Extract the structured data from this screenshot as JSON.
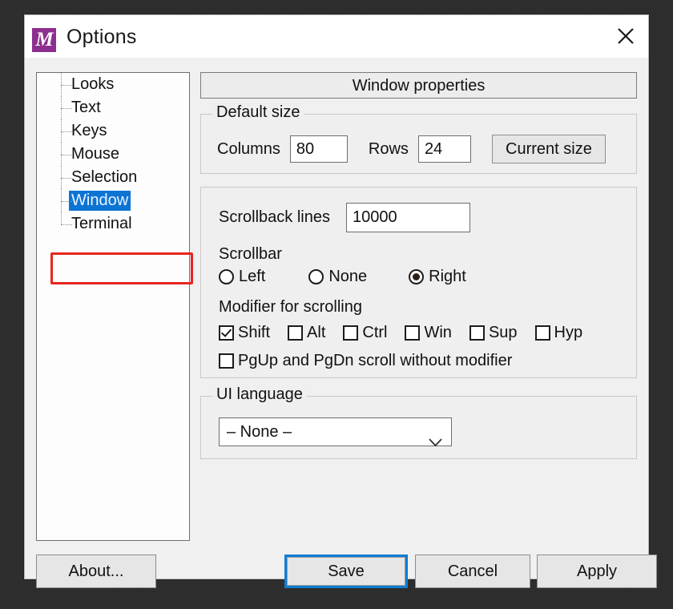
{
  "window": {
    "title": "Options",
    "app_icon_letter": "M",
    "app_icon_color": "#8c2f8e",
    "close_icon": "close-icon"
  },
  "sidebar": {
    "items": [
      {
        "label": "Looks",
        "selected": false
      },
      {
        "label": "Text",
        "selected": false
      },
      {
        "label": "Keys",
        "selected": false
      },
      {
        "label": "Mouse",
        "selected": false
      },
      {
        "label": "Selection",
        "selected": false
      },
      {
        "label": "Window",
        "selected": true
      },
      {
        "label": "Terminal",
        "selected": false
      }
    ],
    "selection_bg": "#0d74d4",
    "selection_fg": "#e8f4ff",
    "annotation_color": "#e8251f"
  },
  "content": {
    "section_header": "Window properties",
    "default_size": {
      "title": "Default size",
      "columns_label": "Columns",
      "columns_value": "80",
      "rows_label": "Rows",
      "rows_value": "24",
      "current_size_button": "Current size"
    },
    "scroll": {
      "scrollback_label": "Scrollback lines",
      "scrollback_value": "10000",
      "scrollbar_label": "Scrollbar",
      "scrollbar_options": [
        {
          "label": "Left",
          "selected": false
        },
        {
          "label": "None",
          "selected": false
        },
        {
          "label": "Right",
          "selected": true
        }
      ],
      "modifier_label": "Modifier for scrolling",
      "modifiers": [
        {
          "label": "Shift",
          "checked": true
        },
        {
          "label": "Alt",
          "checked": false
        },
        {
          "label": "Ctrl",
          "checked": false
        },
        {
          "label": "Win",
          "checked": false
        },
        {
          "label": "Sup",
          "checked": false
        },
        {
          "label": "Hyp",
          "checked": false
        }
      ],
      "pgup_pgdn": {
        "label": "PgUp and PgDn scroll without modifier",
        "checked": false
      }
    },
    "ui_language": {
      "title": "UI language",
      "selected": "– None –",
      "chevron_icon": "chevron-down-icon"
    }
  },
  "buttons": {
    "about": "About...",
    "save": "Save",
    "cancel": "Cancel",
    "apply": "Apply",
    "focus_color": "#0f7dd4"
  }
}
